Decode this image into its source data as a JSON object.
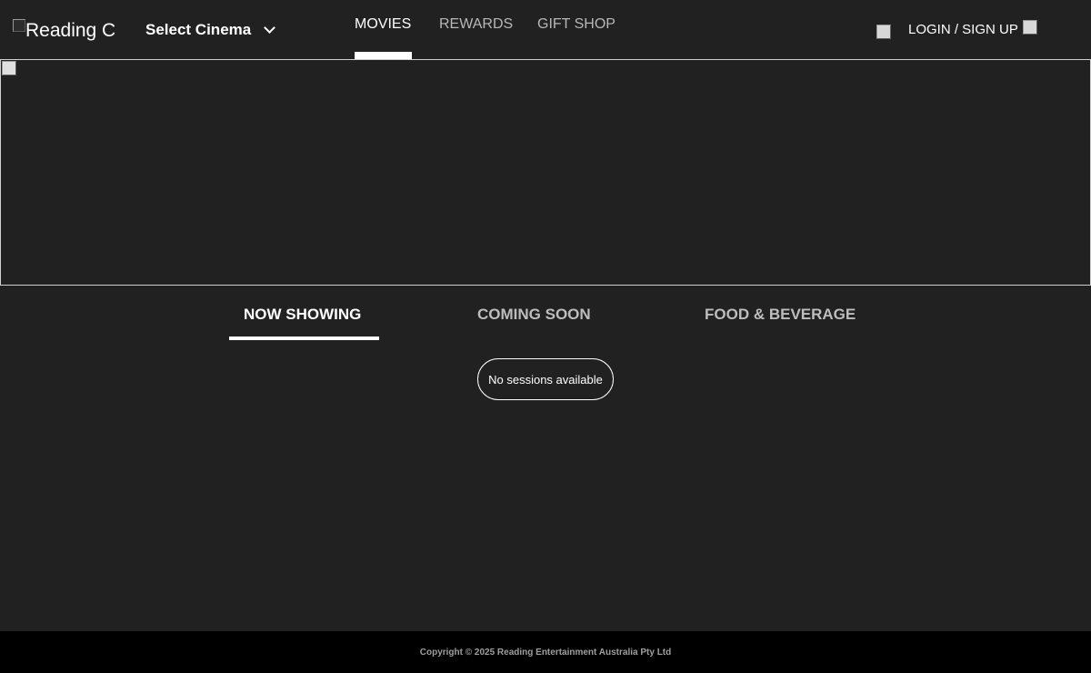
{
  "header": {
    "logo_alt": "Reading C",
    "cinema_select_label": "Select Cinema",
    "nav": [
      {
        "label": "MOVIES",
        "active": true
      },
      {
        "label": "REWARDS",
        "active": false
      },
      {
        "label": "GIFT SHOP",
        "active": false
      }
    ],
    "login_label": "LOGIN / SIGN UP"
  },
  "tabs": [
    {
      "label": "NOW SHOWING",
      "active": true
    },
    {
      "label": "COMING SOON",
      "active": false
    },
    {
      "label": "FOOD & BEVERAGE",
      "active": false
    }
  ],
  "main": {
    "sessions_message": "No sessions available"
  },
  "footer": {
    "copyright": "Copyright © 2025 Reading Entertainment Australia Pty Ltd"
  },
  "colors": {
    "background": "#212121",
    "footer_background": "#000000",
    "text": "#ffffff",
    "muted_text": "#bdbdbd"
  }
}
